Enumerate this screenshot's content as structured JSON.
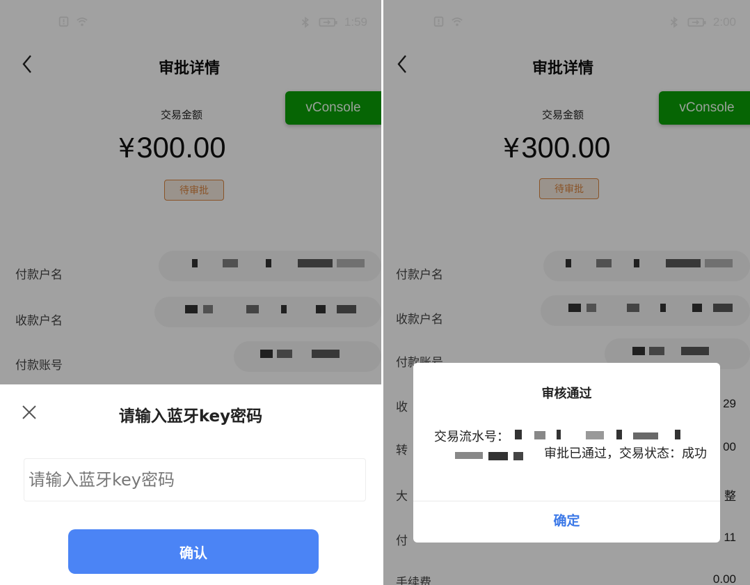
{
  "left": {
    "status": {
      "time": "1:59"
    },
    "nav": {
      "title": "审批详情"
    },
    "vconsole": "vConsole",
    "amount_label": "交易金额",
    "amount": "300.00",
    "currency": "¥",
    "status_badge": "待审批",
    "rows": [
      {
        "label": "付款户名"
      },
      {
        "label": "收款户名"
      },
      {
        "label": "付款账号"
      }
    ],
    "sheet": {
      "title": "请输入蓝牙key密码",
      "input_placeholder": "请输入蓝牙key密码",
      "confirm_label": "确认"
    }
  },
  "right": {
    "status": {
      "time": "2:00"
    },
    "nav": {
      "title": "审批详情"
    },
    "vconsole": "vConsole",
    "amount_label": "交易金额",
    "amount": "300.00",
    "currency": "¥",
    "status_badge": "待审批",
    "rows": [
      {
        "label": "付款户名",
        "value": ""
      },
      {
        "label": "收款户名",
        "value": ""
      },
      {
        "label": "付款账号",
        "value": ""
      },
      {
        "label": "收",
        "value": "29"
      },
      {
        "label": "转",
        "value": "00"
      },
      {
        "label": "大",
        "value": "整"
      },
      {
        "label": "付",
        "value": "11"
      },
      {
        "label": "手续费",
        "value": "0.00"
      }
    ],
    "dialog": {
      "title": "审核通过",
      "serial_label": "交易流水号：",
      "message": "审批已通过，交易状态：成功",
      "ok_label": "确定"
    }
  },
  "colors": {
    "vconsole": "#0aa007",
    "badge": "#d9843f",
    "confirm": "#4b84f5",
    "link": "#3b78e7"
  }
}
